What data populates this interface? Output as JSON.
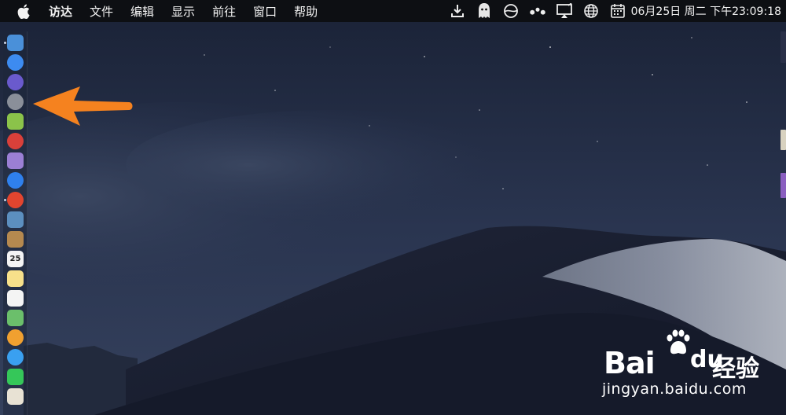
{
  "menubar": {
    "apple_icon": "apple-icon",
    "items": [
      {
        "label": "访达",
        "bold": true
      },
      {
        "label": "文件"
      },
      {
        "label": "编辑"
      },
      {
        "label": "显示"
      },
      {
        "label": "前往"
      },
      {
        "label": "窗口"
      },
      {
        "label": "帮助"
      }
    ],
    "status_icons": [
      "download-icon",
      "ghost-icon",
      "globe-cloud-icon",
      "dots-icon",
      "airplay-icon",
      "language-globe-icon",
      "calendar-icon"
    ],
    "clock": "06月25日 周二 下午23:09:18"
  },
  "dock": {
    "items": [
      {
        "name": "finder-icon",
        "color": "#4a90d9",
        "running": true
      },
      {
        "name": "app-store-icon",
        "color": "#3d8bf0"
      },
      {
        "name": "siri-icon",
        "color": "#6a5acd"
      },
      {
        "name": "launchpad-icon",
        "color": "#8a8f99"
      },
      {
        "name": "android-icon",
        "color": "#8bc34a"
      },
      {
        "name": "red-app-icon",
        "color": "#d9403a"
      },
      {
        "name": "calculator-icon",
        "color": "#9b7fd4"
      },
      {
        "name": "safari-icon",
        "color": "#2f80ed"
      },
      {
        "name": "chrome-icon",
        "color": "#e2452f",
        "running": true
      },
      {
        "name": "preview-icon",
        "color": "#5c8fbf"
      },
      {
        "name": "contacts-icon",
        "color": "#b5894f"
      },
      {
        "name": "calendar-icon",
        "color": "#f4f4f4",
        "text": "25"
      },
      {
        "name": "notes-icon",
        "color": "#f7e08a"
      },
      {
        "name": "reminders-icon",
        "color": "#f4f4f4"
      },
      {
        "name": "maps-icon",
        "color": "#6bbf6b"
      },
      {
        "name": "photos-icon",
        "color": "#f0a030"
      },
      {
        "name": "messages-icon",
        "color": "#3aa0f0"
      },
      {
        "name": "facetime-icon",
        "color": "#35c759"
      },
      {
        "name": "textedit-icon",
        "color": "#e8e2d4"
      }
    ]
  },
  "watermark": {
    "bai": "Bai",
    "du": "du",
    "cn": "经验",
    "url": "jingyan.baidu.com"
  },
  "colors": {
    "arrow": "#f5821f",
    "menubar": "#0d0f13"
  }
}
